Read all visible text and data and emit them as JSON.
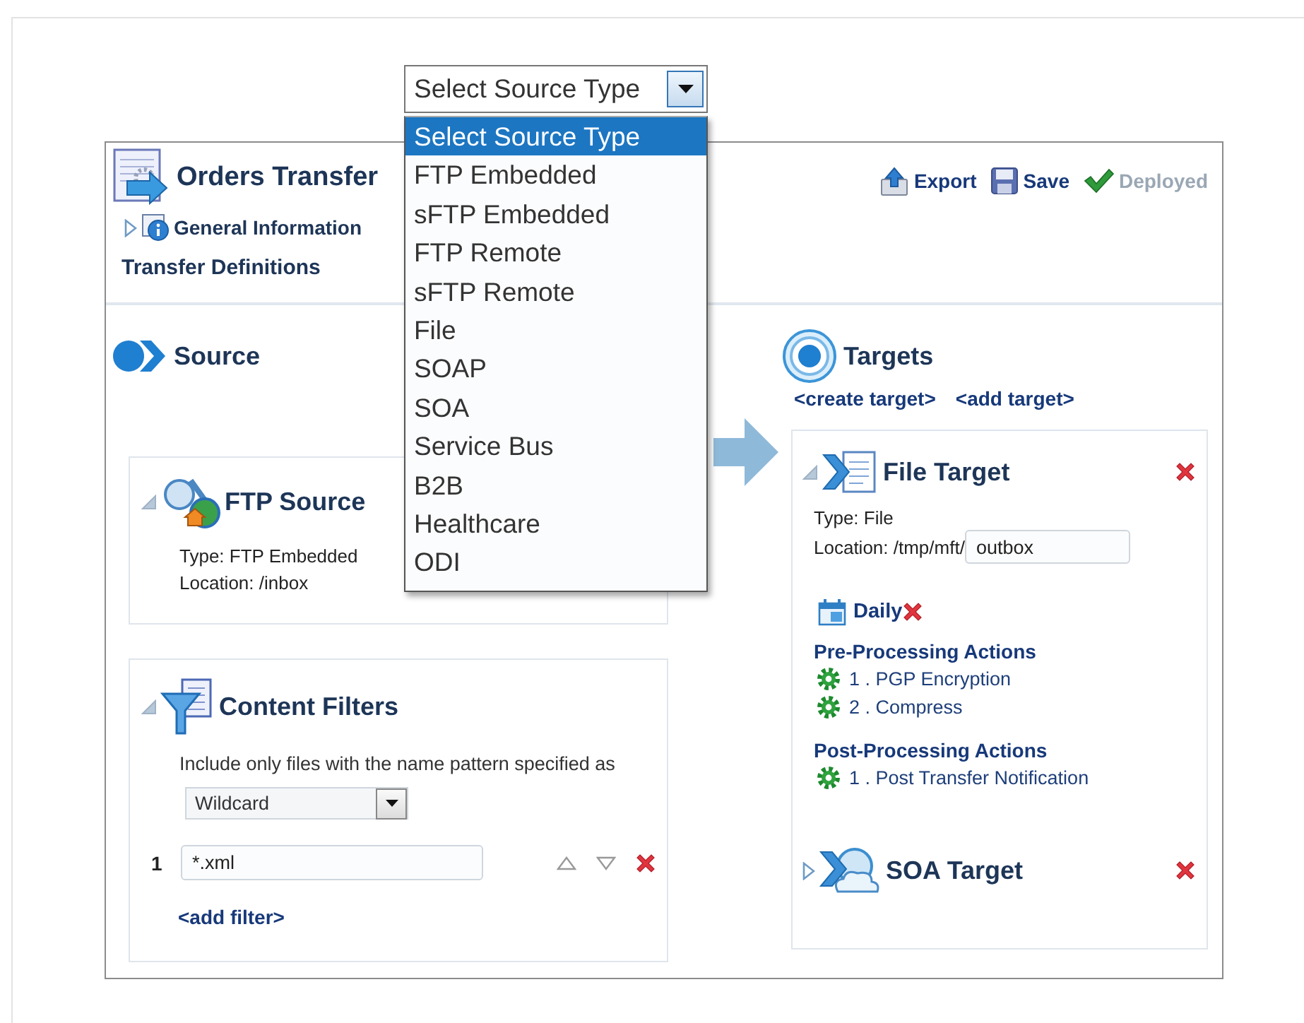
{
  "header": {
    "title": "Orders Transfer",
    "general_information": {
      "label": "General Information",
      "expanded": false
    },
    "section": "Transfer Definitions",
    "actions": [
      {
        "label": "Export",
        "kind": "export",
        "disabled": false
      },
      {
        "label": "Save",
        "kind": "save",
        "disabled": false
      },
      {
        "label": "Deployed",
        "kind": "status",
        "disabled": true
      }
    ]
  },
  "source": {
    "heading": "Source",
    "card": {
      "title": "FTP Source",
      "expanded": true,
      "type": "Type: FTP Embedded",
      "location": "Location: /inbox"
    }
  },
  "content_filters": {
    "title": "Content Filters",
    "expanded": true,
    "description": "Include only files with the name pattern specified as",
    "pattern_type": "Wildcard",
    "filters": [
      {
        "number": "1",
        "value": "*.xml"
      }
    ],
    "add_link": "<add filter>"
  },
  "targets": {
    "heading": "Targets",
    "links": [
      "<create target>",
      "<add target>"
    ],
    "items": [
      {
        "kind": "file",
        "title": "File Target",
        "expanded": true,
        "type": "Type: File",
        "location_prefix": "Location: /tmp/mft/",
        "location_value": "outbox",
        "schedule": "Daily",
        "pre_heading": "Pre-Processing Actions",
        "pre_actions": [
          "1 . PGP Encryption",
          "2 . Compress"
        ],
        "post_heading": "Post-Processing Actions",
        "post_actions": [
          "1 . Post Transfer Notification"
        ]
      },
      {
        "kind": "soa",
        "title": "SOA Target",
        "expanded": false
      }
    ]
  },
  "dropdown": {
    "value": "Select Source Type",
    "options": [
      {
        "label": "Select Source Type",
        "selected": true
      },
      {
        "label": "FTP Embedded",
        "selected": false
      },
      {
        "label": "sFTP Embedded",
        "selected": false
      },
      {
        "label": "FTP Remote",
        "selected": false
      },
      {
        "label": "sFTP Remote",
        "selected": false
      },
      {
        "label": "File",
        "selected": false
      },
      {
        "label": "SOAP",
        "selected": false
      },
      {
        "label": "SOA",
        "selected": false
      },
      {
        "label": "Service Bus",
        "selected": false
      },
      {
        "label": "B2B",
        "selected": false
      },
      {
        "label": "Healthcare",
        "selected": false
      },
      {
        "label": "ODI",
        "selected": false
      }
    ]
  }
}
